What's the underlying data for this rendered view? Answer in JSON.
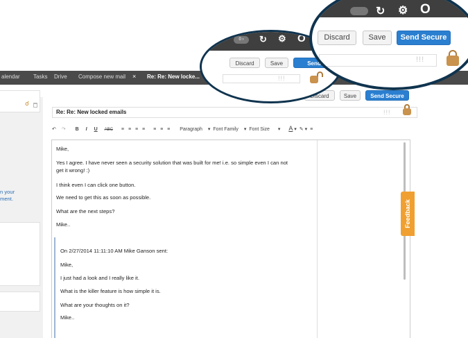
{
  "nav": {
    "items": [
      "alendar",
      "Tasks",
      "Drive",
      "Compose new mail"
    ],
    "close_glyph": "×",
    "active_tab": "Re: Re: New locke..."
  },
  "actions": {
    "discard": "Discard",
    "save": "Save",
    "send_secure": "Send Secure",
    "send_partial": "Send"
  },
  "subject": {
    "value": "Re:  Re: New locked emails"
  },
  "toolbar": {
    "paragraph": "Paragraph",
    "font_family": "Font Family",
    "font_size": "Font Size",
    "bold": "B",
    "italic": "I",
    "underline": "U",
    "strike": "ABC"
  },
  "sidebar": {
    "snippet1": "n your",
    "snippet2": "ment."
  },
  "body": {
    "lines": [
      "Mike,",
      "Yes I agree. I have never seen a security solution that was built for me! i.e. so simple even I can not",
      "get it wrong! :)",
      "I think even I can click one button.",
      "We need to get this as soon as possible.",
      "What are the next steps?",
      "Mike.."
    ],
    "quote_header": "On 2/27/2014 11:11:10 AM Mike Ganson sent:",
    "quote_lines": [
      "Mike,",
      "I just had a look and I really like it.",
      "What is the killer feature is how simple it is.",
      "What are your thoughts on it?",
      "Mike.."
    ]
  },
  "feedback": "Feedback",
  "header_logo": "O",
  "pill_text": "0 ›",
  "icons": {
    "refresh": "refresh-icon",
    "settings": "gear-icon",
    "lock": "lock-icon",
    "search": "search-icon",
    "trash": "trash-icon"
  },
  "colors": {
    "primary": "#2b7fd0",
    "bubble_border": "#10344f",
    "feedback": "#f0a030",
    "lock": "#c9924d"
  }
}
